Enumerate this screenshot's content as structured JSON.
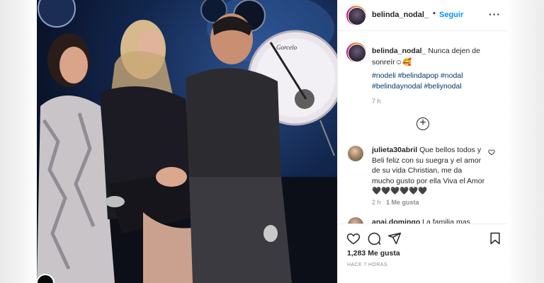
{
  "post": {
    "username": "belinda_nodal_",
    "follow_label": "Seguir",
    "separator": "•",
    "more_label": "···",
    "caption": {
      "username": "belinda_nodal_",
      "text": "Nunca dejen de sonreír☺🥰",
      "hashtags": "#nodeli #belindapop #nodal #belindaynodal #beliynodal",
      "time": "7 h"
    },
    "load_more_label": "+",
    "comments": [
      {
        "username": "julieta30abril",
        "text": "Que bellos todos y Beli feliz con su suegra y el amor de su vida Christian, me da mucho gusto por ella Viva el Amor🖤🖤🖤🖤🖤🖤",
        "time": "2 h",
        "likes": "1 Me gusta"
      },
      {
        "username": "anai.domingo",
        "text": "La familia mas"
      }
    ],
    "likes_count": "1,283 Me gusta",
    "age": "HACE 7 HORAS",
    "icons": {
      "like": "heart-icon",
      "comment": "comment-icon",
      "share": "share-icon",
      "save": "bookmark-icon",
      "more": "more-options-icon",
      "load_more": "plus-circle-icon"
    },
    "colors": {
      "link": "#0095f6",
      "hashtag": "#00376b",
      "text": "#262626",
      "muted": "#8e8e8e"
    }
  },
  "photo": {
    "drum_brand": "Gorcelo"
  }
}
